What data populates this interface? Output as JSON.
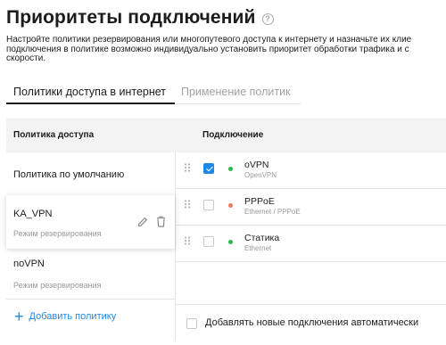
{
  "header": {
    "title": "Приоритеты подключений",
    "help_icon": "question-circle-icon"
  },
  "description": {
    "line1": "Настройте политики резервирования или многопутевого доступа к интернету и назначьте их клие",
    "line2": "подключения в политике возможно индивидуально установить приоритет обработки трафика и с",
    "line3": "скорости."
  },
  "tabs": [
    {
      "label": "Политики доступа в интернет",
      "active": true
    },
    {
      "label": "Применение политик",
      "active": false
    }
  ],
  "table": {
    "policies_header": "Политика доступа",
    "connections_header": "Подключение"
  },
  "policies": [
    {
      "name": "Политика по умолчанию",
      "subtitle": ""
    },
    {
      "name": "KA_VPN",
      "subtitle": "Режим резервирования",
      "selected": true
    },
    {
      "name": "noVPN",
      "subtitle": "Режим резервирования"
    }
  ],
  "add_policy_label": "Добавить политику",
  "connections": [
    {
      "name": "oVPN",
      "type": "OpenVPN",
      "checked": true,
      "status_color": "#2db84d"
    },
    {
      "name": "PPPoE",
      "type": "Ethernet / PPPoE",
      "checked": false,
      "status_color": "#f07b5c"
    },
    {
      "name": "Статика",
      "type": "Ethernet",
      "checked": false,
      "status_color": "#2db84d"
    }
  ],
  "auto_add_label": "Добавлять новые подключения автоматически",
  "colors": {
    "accent": "#1e88e5",
    "status_ok": "#2db84d",
    "status_error": "#f07b5c",
    "header_bg": "#f3f3f3"
  }
}
